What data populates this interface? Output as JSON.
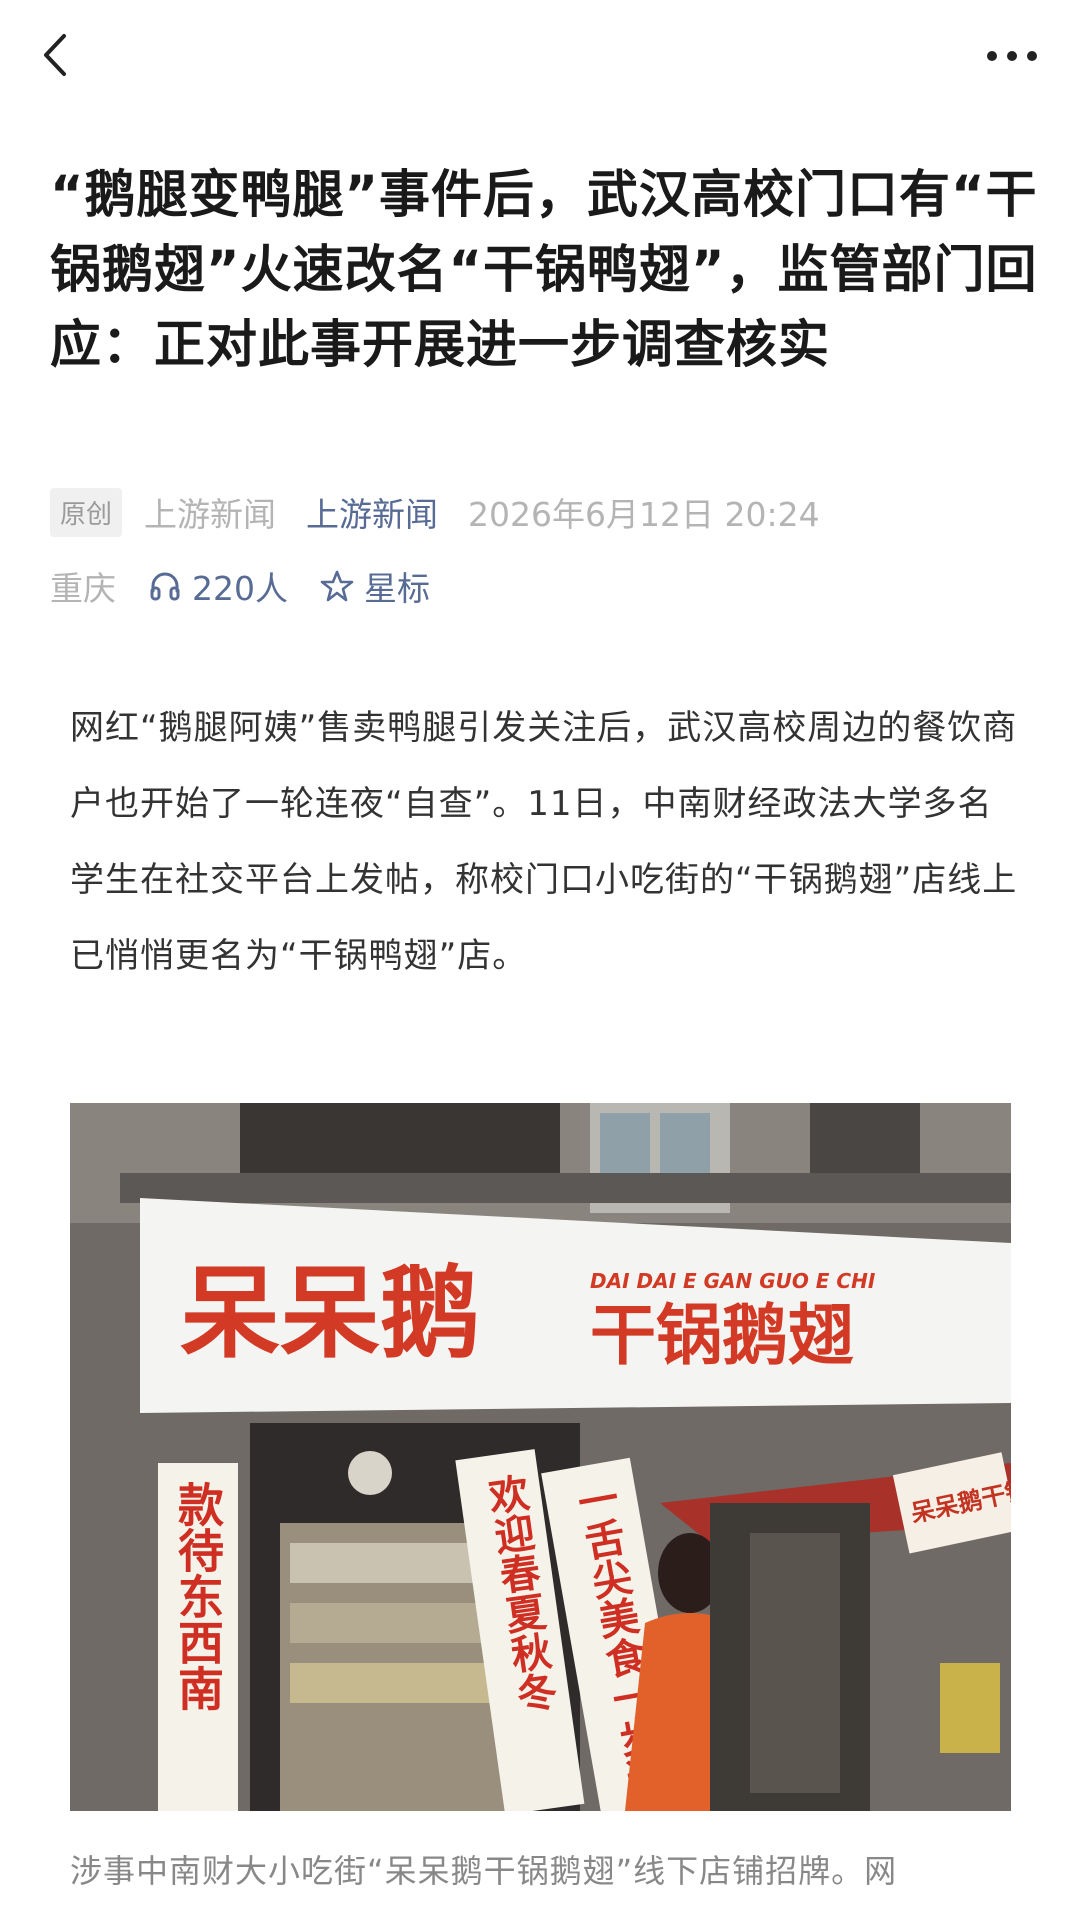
{
  "nav": {
    "back_icon": "chevron-left-icon",
    "more_icon": "more-dots-icon"
  },
  "article": {
    "title": "“鹅腿变鸭腿”事件后，武汉高校门口有“干锅鹅翅”火速改名“干锅鸭翅”，监管部门回应：正对此事开展进一步调查核实",
    "badge": "原创",
    "source": "上游新闻",
    "account": "上游新闻",
    "date": "2026年6月12日 20:24",
    "region": "重庆",
    "listen_icon": "headphones-icon",
    "listeners": "220人",
    "star_icon": "star-icon",
    "star_label": "星标",
    "body": "网红“鹅腿阿姨”售卖鸭腿引发关注后，武汉高校周边的餐饮商户也开始了一轮连夜“自查”。11日，中南财经政法大学多名学生在社交平台上发帖，称校门口小吃街的“干锅鹅翅”店线上已悄悄更名为“干锅鸭翅”店。",
    "photo": {
      "sign_brand": "呆呆鹅",
      "sign_pinyin": "DAI DAI E GAN GUO E CHI",
      "sign_name": "干锅鹅翅",
      "couplet_left": "款待东西南",
      "couplet_mid": "欢迎春夏秋冬",
      "couplet_right": "一舌尖美食一步道",
      "side_sign": "呆呆鹅干锅"
    },
    "caption": "涉事中南财大小吃街“呆呆鹅干锅鹅翅”线下店铺招牌。网"
  },
  "colors": {
    "link": "#576b95",
    "meta": "#b4b4b4",
    "title": "#1a1a1a",
    "sign_red": "#d23a25"
  }
}
